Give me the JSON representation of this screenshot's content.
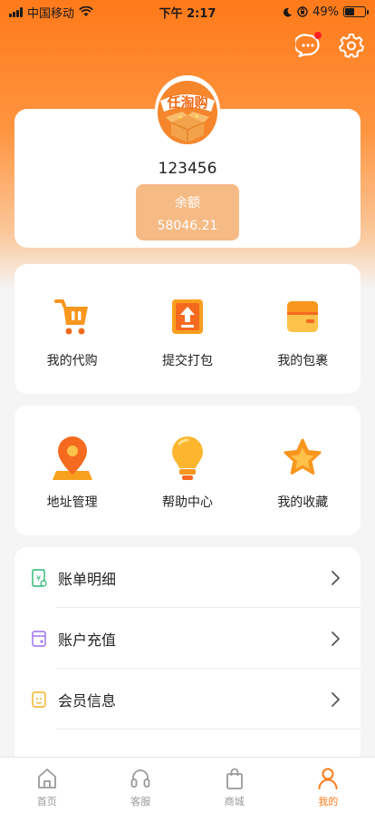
{
  "status": {
    "carrier": "中国移动",
    "time": "下午 2:17",
    "battery": "49%",
    "battery_level": 0.49
  },
  "profile": {
    "logo_text": "任淘购",
    "username": "123456",
    "balance_label": "余额",
    "balance_value": "58046.21"
  },
  "grid1": [
    {
      "label": "我的代购",
      "icon": "cart-icon"
    },
    {
      "label": "提交打包",
      "icon": "upload-box-icon"
    },
    {
      "label": "我的包裹",
      "icon": "package-icon"
    }
  ],
  "grid2": [
    {
      "label": "地址管理",
      "icon": "location-pin-icon"
    },
    {
      "label": "帮助中心",
      "icon": "lightbulb-icon"
    },
    {
      "label": "我的收藏",
      "icon": "star-icon"
    }
  ],
  "list": [
    {
      "label": "账单明细",
      "icon": "bill-icon"
    },
    {
      "label": "账户充值",
      "icon": "recharge-icon"
    },
    {
      "label": "会员信息",
      "icon": "member-icon"
    }
  ],
  "tabs": [
    {
      "label": "首页",
      "icon": "home-icon"
    },
    {
      "label": "客服",
      "icon": "headset-icon"
    },
    {
      "label": "商城",
      "icon": "shopping-bag-icon"
    },
    {
      "label": "我的",
      "icon": "user-icon",
      "active": true
    }
  ],
  "colors": {
    "accent": "#ff7a1a",
    "balance_bg": "#f6ba85",
    "notification_dot": "#ff1f1f"
  }
}
